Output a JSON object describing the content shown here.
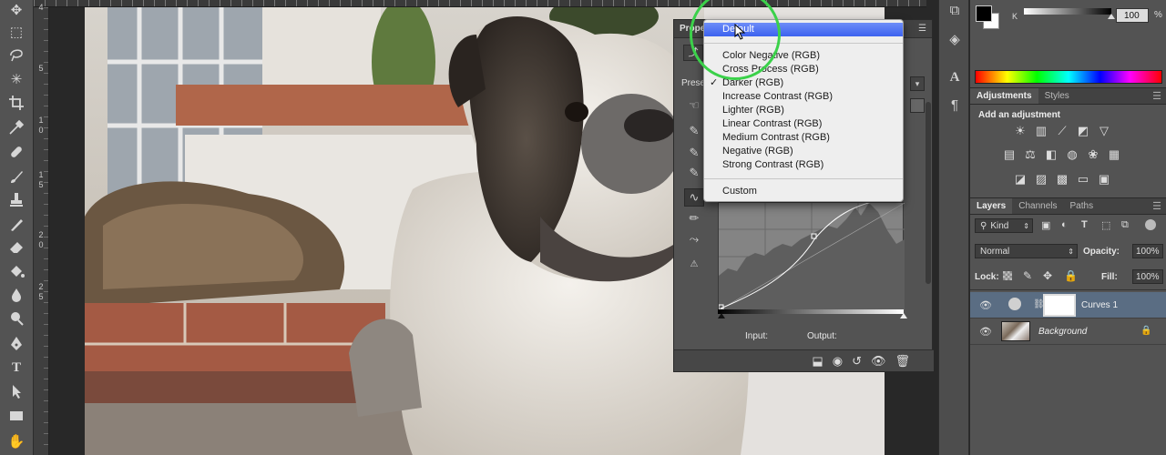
{
  "ruler": {
    "marks": [
      "4",
      "5",
      "1",
      "0",
      "1",
      "5",
      "2",
      "0",
      "2",
      "5"
    ]
  },
  "properties": {
    "title": "Prope",
    "preset_label": "Prese",
    "input_label": "Input:",
    "output_label": "Output:"
  },
  "preset_menu": {
    "items": [
      {
        "label": "Default",
        "highlighted": true,
        "checked": false
      },
      {
        "label": "Color Negative (RGB)",
        "highlighted": false,
        "checked": false
      },
      {
        "label": "Cross Process (RGB)",
        "highlighted": false,
        "checked": false
      },
      {
        "label": "Darker (RGB)",
        "highlighted": false,
        "checked": true
      },
      {
        "label": "Increase Contrast (RGB)",
        "highlighted": false,
        "checked": false
      },
      {
        "label": "Lighter (RGB)",
        "highlighted": false,
        "checked": false
      },
      {
        "label": "Linear Contrast (RGB)",
        "highlighted": false,
        "checked": false
      },
      {
        "label": "Medium Contrast (RGB)",
        "highlighted": false,
        "checked": false
      },
      {
        "label": "Negative (RGB)",
        "highlighted": false,
        "checked": false
      },
      {
        "label": "Strong Contrast (RGB)",
        "highlighted": false,
        "checked": false
      }
    ],
    "custom_label": "Custom",
    "check_glyph": "✓"
  },
  "color_panel": {
    "channel_label": "K",
    "value": "100",
    "unit": "%",
    "slider_level": 1.0,
    "foreground": "#000000",
    "background": "#ffffff"
  },
  "adjustments_panel": {
    "tabs": [
      "Adjustments",
      "Styles"
    ],
    "active_tab": "Adjustments",
    "heading": "Add an adjustment",
    "icons": [
      "brightness-contrast-icon",
      "levels-icon",
      "curves-icon",
      "exposure-icon",
      "vibrance-icon",
      "hue-saturation-icon",
      "color-balance-icon",
      "black-white-icon",
      "photo-filter-icon",
      "channel-mixer-icon",
      "color-lookup-icon",
      "invert-icon",
      "posterize-icon",
      "threshold-icon",
      "gradient-map-icon",
      "selective-color-icon"
    ]
  },
  "layers_panel": {
    "tabs": [
      "Layers",
      "Channels",
      "Paths"
    ],
    "active_tab": "Layers",
    "filter_kind": "Kind",
    "blend_mode": "Normal",
    "opacity_label": "Opacity:",
    "opacity_value": "100%",
    "lock_label": "Lock:",
    "fill_label": "Fill:",
    "fill_value": "100%",
    "layers": [
      {
        "name": "Curves 1",
        "selected": true
      },
      {
        "name": "Background",
        "selected": false,
        "locked": true
      }
    ]
  },
  "colors": {
    "menu_highlight": "#4a6cf3",
    "annotation_circle": "#3bd14a",
    "selected_layer": "#5a6d83"
  }
}
